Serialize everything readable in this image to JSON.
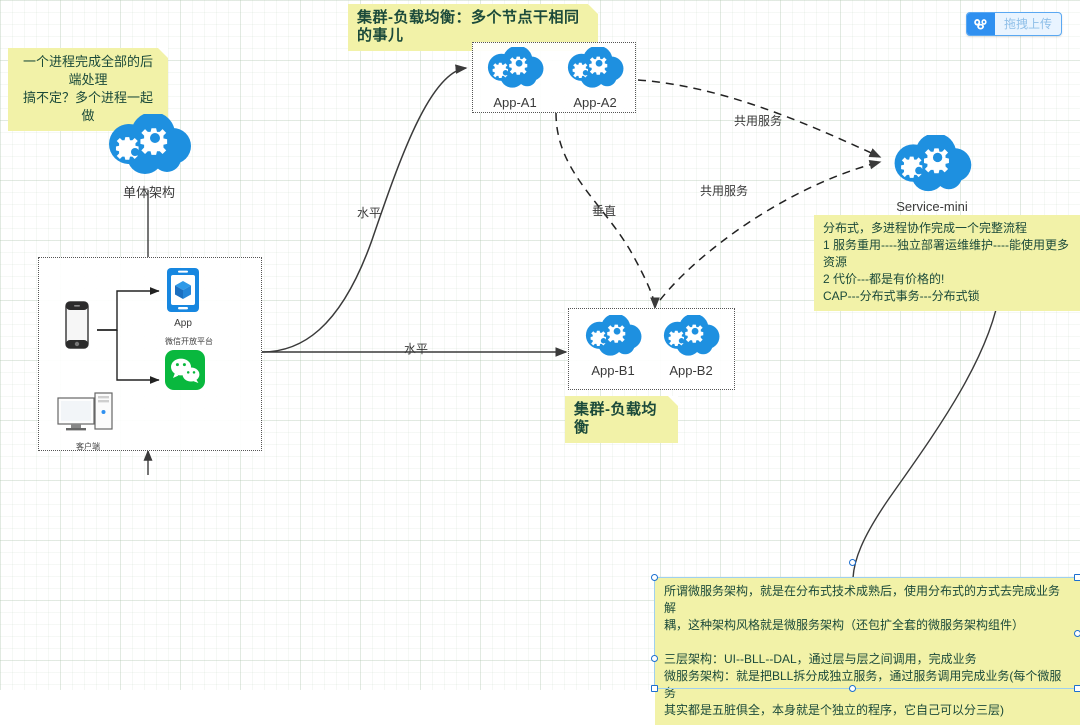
{
  "toolbar": {
    "upload_button_label": "拖拽上传",
    "upload_icon": "baidu-cloud-icon"
  },
  "notes": {
    "top_left": "一个进程完成全部的后端处理\n搞不定？多个进程一起做",
    "top_center": "集群-负载均衡：多个节点干相同的事儿",
    "cluster_b": "集群-负载均衡",
    "right": "分布式，多进程协作完成一个完整流程\n1 服务重用----独立部署运维维护----能使用更多资源\n2 代价---都是有价格的!\nCAP---分布式事务---分布式锁",
    "bottom": "所谓微服务架构，就是在分布式技术成熟后，使用分布式的方式去完成业务解\n耦，这种架构风格就是微服务架构（还包扩全套的微服务架构组件）\n\n三层架构：UI--BLL--DAL，通过层与层之间调用，完成业务\n微服务架构：就是把BLL拆分成独立服务，通过服务调用完成业务(每个微服务\n其实都是五脏俱全，本身就是个独立的程序，它自己可以分三层)"
  },
  "nodes": {
    "mono": {
      "label": "单体架构",
      "icon": "cloud-gears-icon"
    },
    "app_a1": {
      "label": "App-A1",
      "icon": "cloud-gears-icon"
    },
    "app_a2": {
      "label": "App-A2",
      "icon": "cloud-gears-icon"
    },
    "app_b1": {
      "label": "App-B1",
      "icon": "cloud-gears-icon"
    },
    "app_b2": {
      "label": "App-B2",
      "icon": "cloud-gears-icon"
    },
    "service_mini": {
      "label": "Service-mini",
      "icon": "cloud-gears-icon"
    }
  },
  "client_box": {
    "phone_label": "",
    "app_label": "App",
    "wechat_label": "微信开放平台",
    "pc_label": "客户端"
  },
  "edges": [
    {
      "label": "水平"
    },
    {
      "label": "水平"
    },
    {
      "label": "垂直"
    },
    {
      "label": "共用服务"
    },
    {
      "label": "共用服务"
    }
  ],
  "edge_labels": {
    "horizontal_up": "水平",
    "horizontal_mid": "水平",
    "vertical": "垂直",
    "shared_service_top": "共用服务",
    "shared_service_mid": "共用服务"
  },
  "colors": {
    "cloud_blue": "#1e90e0",
    "note_yellow": "#f2f2a8",
    "wechat_green": "#09b83e",
    "app_blue": "#1787e0",
    "accent": "#2f90f0"
  }
}
